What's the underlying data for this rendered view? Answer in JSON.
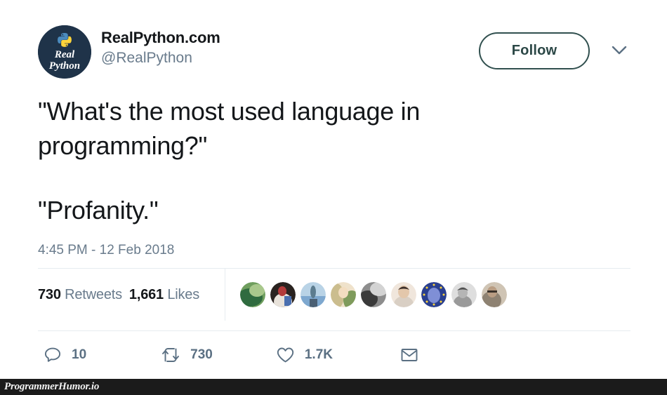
{
  "tweet": {
    "author_name": "RealPython.com",
    "author_handle": "@RealPython",
    "avatar": {
      "icon": "real-python-logo",
      "bg_color": "#1f3349",
      "script_line1": "Real",
      "script_line2": "Python",
      "python_blue": "#4b8bbe",
      "python_yellow": "#ffd43b"
    },
    "follow_label": "Follow",
    "caret_icon": "chevron-down-icon",
    "text_line1": "\"What's the most used language in\nprogramming?\"",
    "text_line2": "\"Profanity.\"",
    "timestamp": "4:45 PM - 12 Feb 2018",
    "stats": {
      "retweets_count": "730",
      "retweets_label": "Retweets",
      "likes_count": "1,661",
      "likes_label": "Likes"
    },
    "facepile": [
      {
        "name": "liker-avatar-1",
        "c1": "#6f9e5e",
        "c2": "#2f6b3f",
        "c3": "#a9c88c"
      },
      {
        "name": "liker-avatar-2",
        "c1": "#2a2320",
        "c2": "#b33b3b",
        "c3": "#e8e2da"
      },
      {
        "name": "liker-avatar-3",
        "c1": "#7ea8cf",
        "c2": "#4a5f73",
        "c3": "#b9d3e6"
      },
      {
        "name": "liker-avatar-4",
        "c1": "#cbbd8e",
        "c2": "#7f9b5c",
        "c3": "#efe2cb"
      },
      {
        "name": "liker-avatar-5",
        "c1": "#8d8d8d",
        "c2": "#3a3a3a",
        "c3": "#d3d3d3"
      },
      {
        "name": "liker-avatar-6",
        "c1": "#d9cfc4",
        "c2": "#3b2f2a",
        "c3": "#f0e6dc"
      },
      {
        "name": "liker-avatar-7",
        "c1": "#2a3f8f",
        "c2": "#ffd43b",
        "c3": "#7f8fd6"
      },
      {
        "name": "liker-avatar-8",
        "c1": "#9a9a9a",
        "c2": "#4a4a4a",
        "c3": "#dedede"
      },
      {
        "name": "liker-avatar-9",
        "c1": "#8e8272",
        "c2": "#3a322a",
        "c3": "#cfc4b4"
      }
    ],
    "actions": {
      "reply": {
        "icon": "reply-icon",
        "count": "10"
      },
      "retweet": {
        "icon": "retweet-icon",
        "count": "730"
      },
      "like": {
        "icon": "heart-icon",
        "count": "1.7K"
      },
      "message": {
        "icon": "envelope-icon",
        "count": ""
      }
    }
  },
  "footer": {
    "watermark": "ProgrammerHumor.io"
  },
  "colors": {
    "text_primary": "#14171a",
    "text_muted": "#697b8c",
    "action_icon": "#5b7083",
    "divider": "#e6ecf0",
    "follow_border": "#31504f",
    "footer_bg": "#1b1b1b"
  }
}
